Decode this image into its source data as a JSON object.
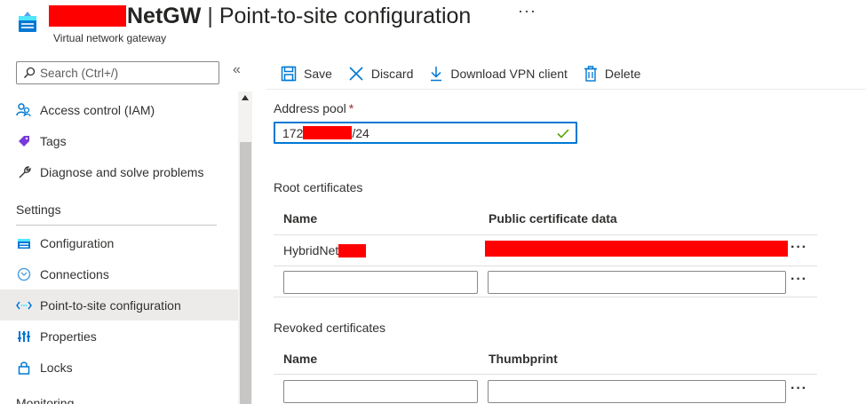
{
  "header": {
    "title_name": "NetGW",
    "title_separator": "|",
    "title_page": "Point-to-site configuration",
    "more_label": "···",
    "subtitle": "Virtual network gateway"
  },
  "sidebar": {
    "search_placeholder": "Search (Ctrl+/)",
    "collapse_label": "«",
    "items_top": [
      {
        "label": "Access control (IAM)",
        "icon": "people-icon"
      },
      {
        "label": "Tags",
        "icon": "tag-icon"
      },
      {
        "label": "Diagnose and solve problems",
        "icon": "wrench-icon"
      }
    ],
    "section_settings": "Settings",
    "items_settings": [
      {
        "label": "Configuration",
        "icon": "configuration-icon"
      },
      {
        "label": "Connections",
        "icon": "connections-icon"
      },
      {
        "label": "Point-to-site configuration",
        "icon": "point-to-site-icon",
        "active": true
      },
      {
        "label": "Properties",
        "icon": "properties-icon"
      },
      {
        "label": "Locks",
        "icon": "lock-icon"
      }
    ],
    "section_monitoring": "Monitoring"
  },
  "toolbar": {
    "save": "Save",
    "discard": "Discard",
    "download": "Download VPN client",
    "delete": "Delete"
  },
  "form": {
    "address_pool_label": "Address pool",
    "required_mark": "*",
    "address_prefix": "172",
    "address_suffix": "/24",
    "root_certificates_title": "Root certificates",
    "root_col_name": "Name",
    "root_col_data": "Public certificate data",
    "root_row_name": "HybridNet",
    "revoked_certificates_title": "Revoked certificates",
    "revoked_col_name": "Name",
    "revoked_col_thumb": "Thumbprint",
    "row_more": "···"
  },
  "colors": {
    "accent": "#0078d4",
    "redaction": "#ff0000",
    "success": "#57a300"
  }
}
